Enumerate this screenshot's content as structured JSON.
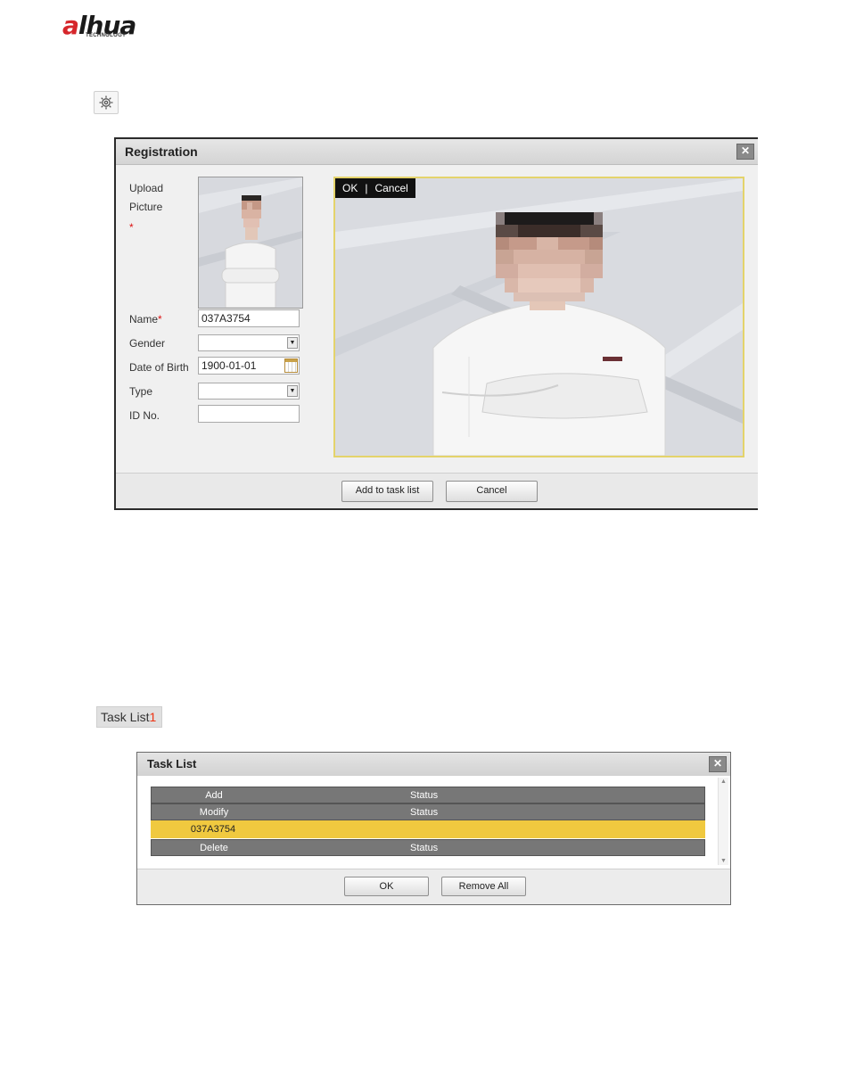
{
  "logo": {
    "brand_a": "a",
    "brand_rest": "lhua",
    "tagline": "TECHNOLOGY"
  },
  "toolbar": {
    "settings_icon": "gear-icon"
  },
  "registration": {
    "title": "Registration",
    "close_icon": "close-icon",
    "upload_label_1": "Upload",
    "upload_label_2": "Picture",
    "required_mark": "*",
    "name_label": "Name",
    "name_value": "037A3754",
    "gender_label": "Gender",
    "gender_value": "",
    "dob_label": "Date of Birth",
    "dob_value": "1900-01-01",
    "type_label": "Type",
    "type_value": "",
    "id_label": "ID No.",
    "id_value": "",
    "crop_ok": "OK",
    "crop_sep": "|",
    "crop_cancel": "Cancel",
    "add_button": "Add to task list",
    "cancel_button": "Cancel"
  },
  "task_button": {
    "label": "Task List",
    "count": "1"
  },
  "task_list": {
    "title": "Task List",
    "close_icon": "close-icon",
    "rows": [
      {
        "col1": "Add",
        "col2": "Status",
        "style": "gray"
      },
      {
        "col1": "Modify",
        "col2": "Status",
        "style": "gray"
      },
      {
        "col1": "037A3754",
        "col2": "",
        "style": "selected"
      },
      {
        "col1": "Delete",
        "col2": "Status",
        "style": "gray"
      }
    ],
    "ok_button": "OK",
    "remove_all_button": "Remove All"
  },
  "colors": {
    "selected_row": "#f0c93f",
    "header_row": "#777777",
    "required": "#dd1111",
    "accent_red": "#d6262b"
  }
}
